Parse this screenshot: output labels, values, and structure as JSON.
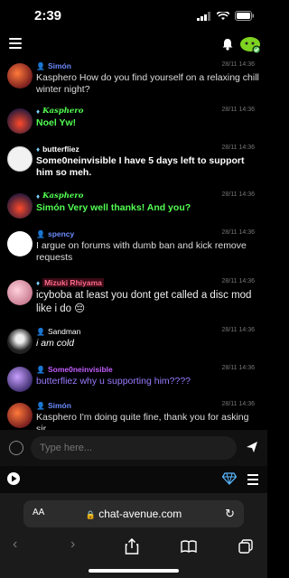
{
  "status_bar": {
    "time": "2:39"
  },
  "messages": [
    {
      "user": "Simón",
      "user_color": "#6a8cff",
      "icon": "person",
      "time": "28/11 14:36",
      "text": "Kasphero How do you find yourself on a relaxing chill winter night?",
      "style": "normal",
      "avatar": "orange"
    },
    {
      "user": "Kasphero",
      "user_color": "#53ff53",
      "icon": "gem",
      "time": "28/11 14:36",
      "text": "Noel Yw!",
      "style": "green",
      "avatar": "red"
    },
    {
      "user": "butterfliez",
      "user_color": "#ffffff",
      "icon": "gem",
      "time": "28/11 14:36",
      "text": "Some0neinvisible I have 5 days left to support him so meh.",
      "style": "bold",
      "avatar": "white"
    },
    {
      "user": "Kasphero",
      "user_color": "#53ff53",
      "icon": "gem",
      "time": "28/11 14:36",
      "text": "Simón Very well thanks! And you?",
      "style": "green",
      "avatar": "red"
    },
    {
      "user": "spency",
      "user_color": "#6a8cff",
      "icon": "person",
      "time": "28/11 14:36",
      "text": "I argue on forums with dumb ban and kick remove requests",
      "style": "normal",
      "avatar": "cat"
    },
    {
      "user": "Mizuki Rhiyama",
      "user_color": "#ff6b8a",
      "icon": "gem",
      "time": "28/11 14:36",
      "text": "icyboba at least you dont get called a disc mod like i do 😔",
      "style": "large",
      "avatar": "pink"
    },
    {
      "user": "Sandman",
      "user_color": "#ffffff",
      "icon": "person",
      "time": "28/11 14:36",
      "text": "i am cold",
      "style": "italic",
      "avatar": "dark"
    },
    {
      "user": "Some0neinvisible",
      "user_color": "#c25dff",
      "icon": "person",
      "time": "28/11 14:36",
      "text": "butterfliez why u supporting him????",
      "style": "purple",
      "avatar": "purple"
    },
    {
      "user": "Simón",
      "user_color": "#6a8cff",
      "icon": "person",
      "time": "28/11 14:36",
      "text": "Kasphero I'm doing quite fine, thank you for asking sir.",
      "style": "normal",
      "avatar": "orange"
    }
  ],
  "input": {
    "placeholder": "Type here..."
  },
  "safari": {
    "aa": "AA",
    "url": "chat-avenue.com"
  }
}
